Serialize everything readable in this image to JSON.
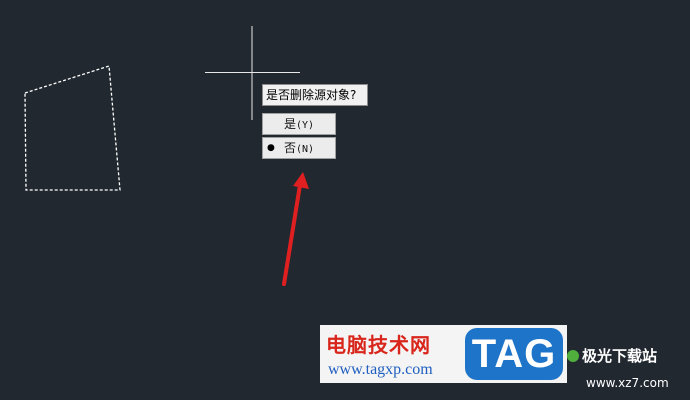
{
  "prompt": {
    "text": "是否删除源对象?"
  },
  "options": [
    {
      "label": "是",
      "key": "(Y)",
      "selected": false
    },
    {
      "label": "否",
      "key": "(N)",
      "selected": true
    }
  ],
  "selected_bullet": "●",
  "watermark": {
    "site_name": "电脑技术网",
    "site_url": "www.tagxp.com",
    "logo_text": "TAG"
  },
  "corner_watermark": {
    "name": "极光下载站",
    "url": "www.xz7.com"
  },
  "colors": {
    "background": "#212830",
    "annotation_arrow": "#e02020",
    "crosshair": "#e8e8e8"
  }
}
